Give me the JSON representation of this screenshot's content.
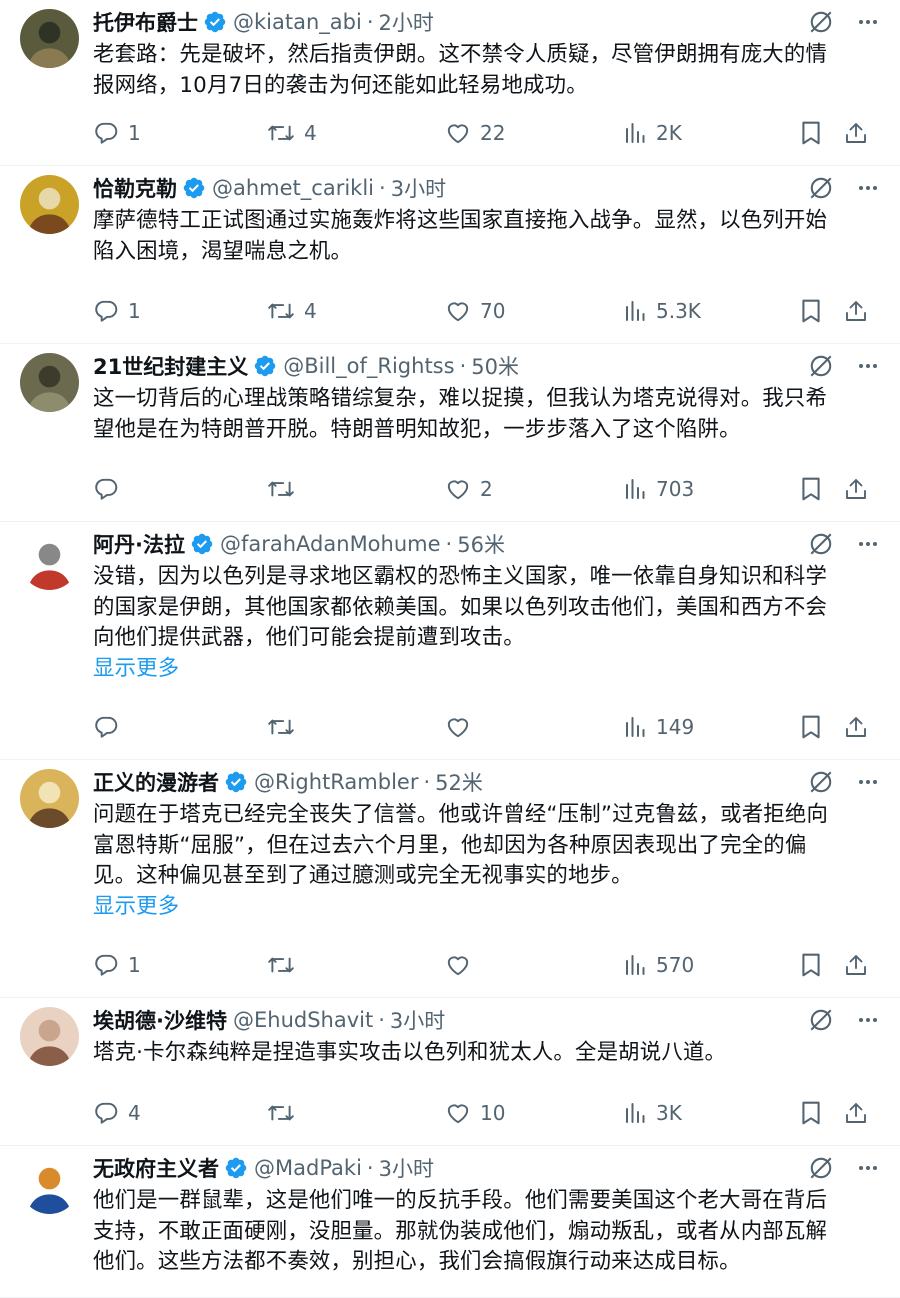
{
  "tweets": [
    {
      "name": "托伊布爵士",
      "handle": "@kiatan_abi",
      "time": "2小时",
      "lines": [
        "老套路：先是破坏，然后指责伊朗。这不禁令人质疑，尽管伊朗拥有庞大的情",
        "报网络，10月7日的袭击为何还能如此轻易地成功。"
      ],
      "show_more": "",
      "replies": "1",
      "retweets": "4",
      "likes": "22",
      "views": "2K",
      "avatar_colors": [
        "#5a5a3c",
        "#8a7a52",
        "#2f3326"
      ]
    },
    {
      "name": "恰勒克勒",
      "handle": "@ahmet_carikli",
      "time": "3小时",
      "lines": [
        "摩萨德特工正试图通过实施轰炸将这些国家直接拖入战争。显然，以色列开始",
        "陷入困境，渴望喘息之机。"
      ],
      "show_more": "",
      "replies": "1",
      "retweets": "4",
      "likes": "70",
      "views": "5.3K",
      "avatar_colors": [
        "#c9a227",
        "#7a4a1e",
        "#e6d8a8"
      ]
    },
    {
      "name": "21世纪封建主义",
      "handle": "@Bill_of_Rightss",
      "time": "50米",
      "lines": [
        "这一切背后的心理战策略错综复杂，难以捉摸，但我认为塔克说得对。我只希",
        "望他是在为特朗普开脱。特朗普明知故犯，一步步落入了这个陷阱。"
      ],
      "show_more": "",
      "replies": "",
      "retweets": "",
      "likes": "2",
      "views": "703",
      "avatar_colors": [
        "#6b6a4e",
        "#8d8c6c",
        "#3c3b2c"
      ]
    },
    {
      "name": "阿丹·法拉",
      "handle": "@farahAdanMohume",
      "time": "56米",
      "lines": [
        "没错，因为以色列是寻求地区霸权的恐怖主义国家，唯一依靠自身知识和科学",
        "的国家是伊朗，其他国家都依赖美国。如果以色列攻击他们，美国和西方不会",
        "向他们提供武器，他们可能会提前遭到攻击。"
      ],
      "show_more": "显示更多",
      "replies": "",
      "retweets": "",
      "likes": "",
      "views": "149",
      "avatar_colors": [
        "#ffffff",
        "#c0392b",
        "#888888"
      ]
    },
    {
      "name": "正义的漫游者",
      "handle": "@RightRambler",
      "time": "52米",
      "lines": [
        "问题在于塔克已经完全丧失了信誉。他或许曾经“压制”过克鲁兹，或者拒绝向",
        "富恩特斯“屈服”，但在过去六个月里，他却因为各种原因表现出了完全的偏",
        "见。这种偏见甚至到了通过臆测或完全无视事实的地步。"
      ],
      "show_more": "显示更多",
      "replies": "1",
      "retweets": "",
      "likes": "",
      "views": "570",
      "avatar_colors": [
        "#d9b45a",
        "#6b4b2a",
        "#f1e3b5"
      ]
    },
    {
      "name": "埃胡德·沙维特",
      "handle": "@EhudShavit",
      "time": "3小时",
      "verified": false,
      "lines": [
        "塔克·卡尔森纯粹是捏造事实攻击以色列和犹太人。全是胡说八道。"
      ],
      "show_more": "",
      "replies": "4",
      "retweets": "",
      "likes": "10",
      "views": "3K",
      "avatar_colors": [
        "#e9d2c2",
        "#8b5e4a",
        "#c9a58e"
      ]
    },
    {
      "name": "无政府主义者",
      "handle": "@MadPaki",
      "time": "3小时",
      "lines": [
        "他们是一群鼠辈，这是他们唯一的反抗手段。他们需要美国这个老大哥在背后",
        "支持，不敢正面硬刚，没胆量。那就伪装成他们，煽动叛乱，或者从内部瓦解",
        "他们。这些方法都不奏效，别担心，我们会搞假旗行动来达成目标。"
      ],
      "show_more": "",
      "replies": "",
      "retweets": "",
      "likes": "",
      "views": "",
      "avatar_colors": [
        "#ffffff",
        "#1f4e9c",
        "#d98b2b"
      ]
    }
  ],
  "colors": {
    "accent": "#1d9bf0",
    "verified": "#1d9bf0",
    "text": "#0f1419",
    "muted": "#536471"
  }
}
